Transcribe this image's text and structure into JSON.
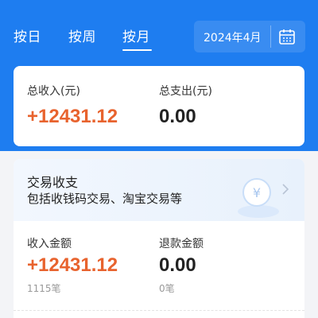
{
  "tabs": {
    "day": "按日",
    "week": "按周",
    "month": "按月"
  },
  "date": {
    "label": "2024年4月"
  },
  "summary": {
    "income_label": "总收入(元)",
    "income_value": "+12431.12",
    "expense_label": "总支出(元)",
    "expense_value": "0.00"
  },
  "trade": {
    "title": "交易收支",
    "subtitle": "包括收钱码交易、淘宝交易等",
    "income_amount_label": "收入金额",
    "income_amount_value": "+12431.12",
    "income_count": "1115笔",
    "refund_amount_label": "退款金额",
    "refund_amount_value": "0.00",
    "refund_count": "0笔"
  },
  "colors": {
    "brand_blue": "#1e7df0",
    "income_orange": "#e8632e"
  },
  "icons": {
    "calendar": "calendar-icon",
    "yuan": "yuan-coin-icon",
    "chevron": "chevron-right-icon"
  }
}
